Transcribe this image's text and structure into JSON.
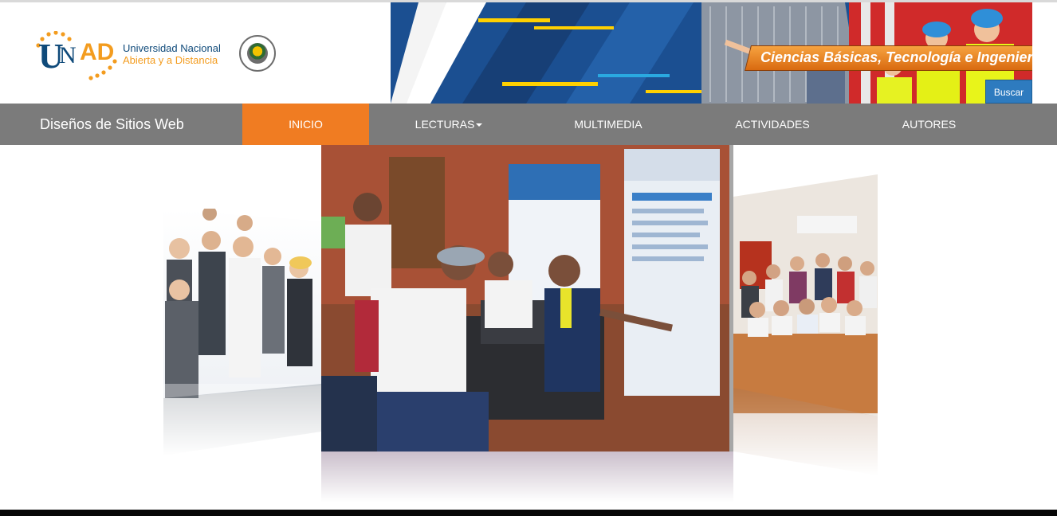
{
  "header": {
    "logo": {
      "line1": "Universidad Nacional",
      "line2": "Abierta y a Distancia"
    },
    "banner_text": "Ciencias Básicas, Tecnología e Ingeniería",
    "search_button": "Buscar"
  },
  "navbar": {
    "brand": "Diseños de Sitios Web",
    "items": [
      {
        "label": "INICIO",
        "active": true
      },
      {
        "label": "LECTURAS",
        "has_dropdown": true
      },
      {
        "label": "MULTIMEDIA"
      },
      {
        "label": "ACTIVIDADES"
      },
      {
        "label": "AUTORES"
      }
    ]
  },
  "carousel": {
    "slides": [
      {
        "position": "left",
        "subject": "group of professionals"
      },
      {
        "position": "center",
        "subject": "people at a table with laptop"
      },
      {
        "position": "right",
        "subject": "group photo in a conference room"
      }
    ]
  },
  "colors": {
    "navbar_bg": "#7b7b7b",
    "nav_active": "#f07c22",
    "unad_blue": "#0f4a7a",
    "unad_orange": "#f39c1f",
    "search_blue": "#2e7bbf"
  }
}
